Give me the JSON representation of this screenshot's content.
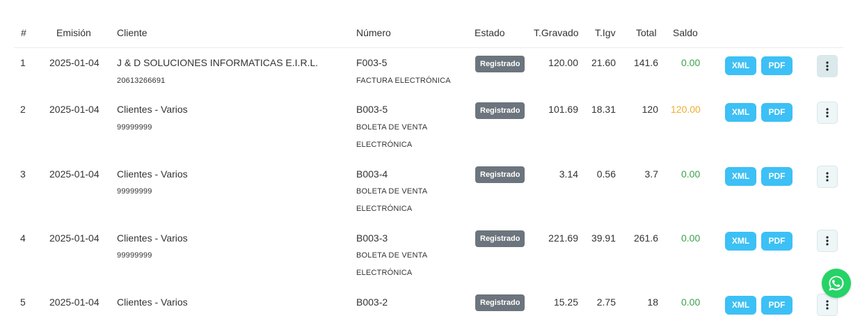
{
  "table": {
    "headers": {
      "index": "#",
      "emision": "Emisión",
      "cliente": "Cliente",
      "numero": "Número",
      "estado": "Estado",
      "t_gravado": "T.Gravado",
      "t_igv": "T.Igv",
      "total": "Total",
      "saldo": "Saldo"
    },
    "rows": [
      {
        "index": "1",
        "emision": "2025-01-04",
        "cliente": "J & D SOLUCIONES INFORMATICAS E.I.R.L.",
        "cliente_doc": "20613266691",
        "numero": "F003-5",
        "tipo_line1": "FACTURA ELECTRÓNICA",
        "tipo_line2": "",
        "estado": "Registrado",
        "t_gravado": "120.00",
        "t_igv": "21.60",
        "total": "141.6",
        "saldo": "0.00",
        "xml": "XML",
        "pdf": "PDF"
      },
      {
        "index": "2",
        "emision": "2025-01-04",
        "cliente": "Clientes - Varios",
        "cliente_doc": "99999999",
        "numero": "B003-5",
        "tipo_line1": "BOLETA DE VENTA",
        "tipo_line2": "ELECTRÓNICA",
        "estado": "Registrado",
        "t_gravado": "101.69",
        "t_igv": "18.31",
        "total": "120",
        "saldo": "120.00",
        "xml": "XML",
        "pdf": "PDF"
      },
      {
        "index": "3",
        "emision": "2025-01-04",
        "cliente": "Clientes - Varios",
        "cliente_doc": "99999999",
        "numero": "B003-4",
        "tipo_line1": "BOLETA DE VENTA",
        "tipo_line2": "ELECTRÓNICA",
        "estado": "Registrado",
        "t_gravado": "3.14",
        "t_igv": "0.56",
        "total": "3.7",
        "saldo": "0.00",
        "xml": "XML",
        "pdf": "PDF"
      },
      {
        "index": "4",
        "emision": "2025-01-04",
        "cliente": "Clientes - Varios",
        "cliente_doc": "99999999",
        "numero": "B003-3",
        "tipo_line1": "BOLETA DE VENTA",
        "tipo_line2": "ELECTRÓNICA",
        "estado": "Registrado",
        "t_gravado": "221.69",
        "t_igv": "39.91",
        "total": "261.6",
        "saldo": "0.00",
        "xml": "XML",
        "pdf": "PDF"
      },
      {
        "index": "5",
        "emision": "2025-01-04",
        "cliente": "Clientes - Varios",
        "cliente_doc": "",
        "numero": "B003-2",
        "tipo_line1": "",
        "tipo_line2": "",
        "estado": "Registrado",
        "t_gravado": "15.25",
        "t_igv": "2.75",
        "total": "18",
        "saldo": "0.00",
        "xml": "XML",
        "pdf": "PDF"
      }
    ]
  },
  "colors": {
    "badge": "#6c757d",
    "button": "#3dc0f5",
    "saldo_zero": "#3aa24b",
    "saldo_pending": "#f0ad2e",
    "whatsapp": "#25d366"
  },
  "icons": {
    "row_menu": "kebab-vertical-icon",
    "chat": "whatsapp-icon"
  }
}
